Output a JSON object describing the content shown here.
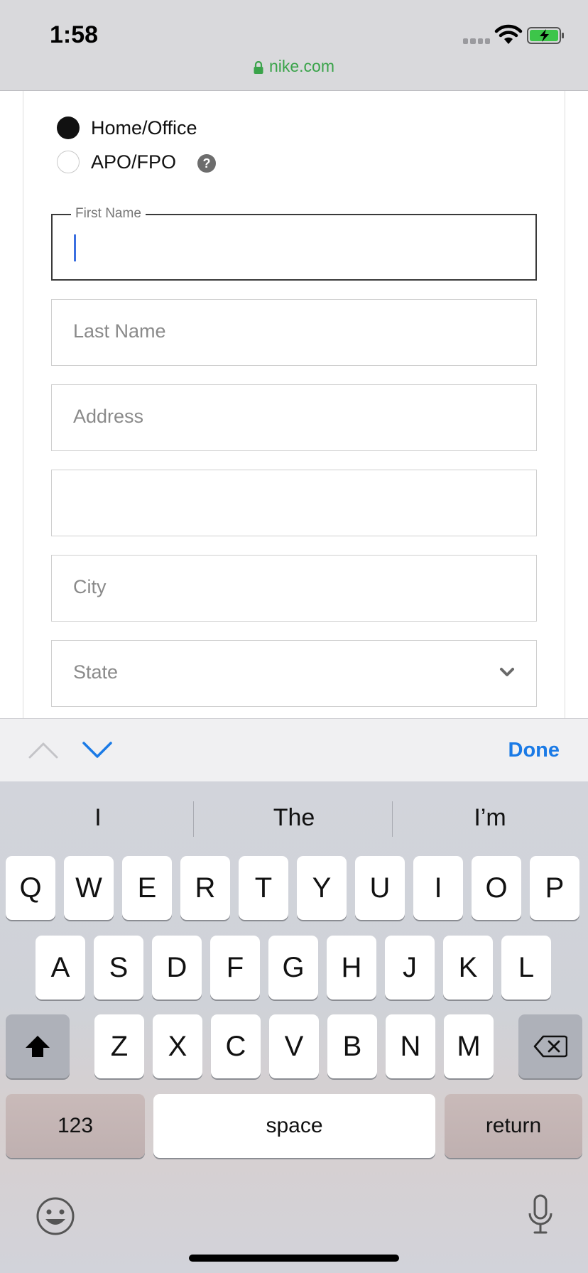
{
  "status_bar": {
    "time": "1:58",
    "url": "nike.com",
    "url_color": "#3aa34a",
    "icons": [
      "signal-icon",
      "wifi-icon",
      "battery-charging-icon",
      "lock-icon"
    ]
  },
  "address_type": {
    "options": [
      {
        "label": "Home/Office",
        "selected": true
      },
      {
        "label": "APO/FPO",
        "selected": false
      }
    ],
    "help_glyph": "?"
  },
  "form": {
    "first_name": {
      "label": "First Name",
      "value": ""
    },
    "last_name": {
      "placeholder": "Last Name",
      "value": ""
    },
    "address": {
      "placeholder": "Address",
      "value": ""
    },
    "address2": {
      "placeholder": "",
      "value": ""
    },
    "city": {
      "placeholder": "City",
      "value": ""
    },
    "state": {
      "placeholder": "State",
      "value": ""
    }
  },
  "accessory_bar": {
    "done_label": "Done",
    "done_color": "#1a7ae6"
  },
  "keyboard": {
    "suggestions": [
      "I",
      "The",
      "I’m"
    ],
    "row1": [
      "Q",
      "W",
      "E",
      "R",
      "T",
      "Y",
      "U",
      "I",
      "O",
      "P"
    ],
    "row2": [
      "A",
      "S",
      "D",
      "F",
      "G",
      "H",
      "J",
      "K",
      "L"
    ],
    "row3": [
      "Z",
      "X",
      "C",
      "V",
      "B",
      "N",
      "M"
    ],
    "numbers_label": "123",
    "space_label": "space",
    "return_label": "return"
  }
}
